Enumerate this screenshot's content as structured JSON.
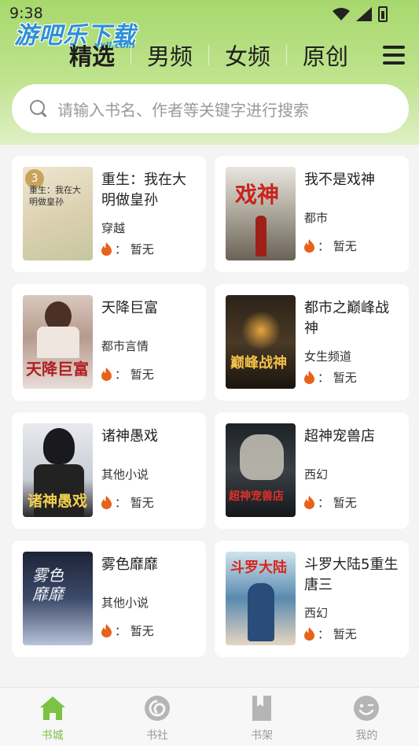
{
  "status_bar": {
    "time": "9:38"
  },
  "watermark": {
    "text": "游吧乐下载",
    "sub": "yxll.com"
  },
  "nav": {
    "tabs": [
      {
        "label": "精选",
        "active": true
      },
      {
        "label": "男频",
        "active": false
      },
      {
        "label": "女频",
        "active": false
      },
      {
        "label": "原创",
        "active": false
      }
    ],
    "menu_icon": "menu-icon"
  },
  "search": {
    "placeholder": "请输入书名、作者等关键字进行搜索",
    "icon": "search-icon"
  },
  "books": [
    {
      "title": "重生：我在大明做皇孙",
      "category": "穿越",
      "heat_label": "：  暂无",
      "cover_badge": "3",
      "cover_text": "重生：我在大明做皇孙"
    },
    {
      "title": "我不是戏神",
      "category": "都市",
      "heat_label": "：  暂无",
      "cover_text": "戏神"
    },
    {
      "title": "天降巨富",
      "category": "都市言情",
      "heat_label": "：  暂无",
      "cover_text": "天降巨富"
    },
    {
      "title": "都市之巅峰战神",
      "category": "女生频道",
      "heat_label": "：  暂无",
      "cover_text": "巅峰战神"
    },
    {
      "title": "诸神愚戏",
      "category": "其他小说",
      "heat_label": "：  暂无",
      "cover_text": "诸神愚戏"
    },
    {
      "title": "超神宠兽店",
      "category": "西幻",
      "heat_label": "：  暂无",
      "cover_text": "超神宠兽店"
    },
    {
      "title": "雾色靡靡",
      "category": "其他小说",
      "heat_label": "：  暂无",
      "cover_text": "雾色靡靡"
    },
    {
      "title": "斗罗大陆5重生唐三",
      "category": "西幻",
      "heat_label": "：  暂无",
      "cover_text": "斗罗大陆"
    }
  ],
  "tabbar": {
    "items": [
      {
        "label": "书城",
        "icon": "home-icon",
        "active": true
      },
      {
        "label": "书社",
        "icon": "community-icon",
        "active": false
      },
      {
        "label": "书架",
        "icon": "bookshelf-icon",
        "active": false
      },
      {
        "label": "我的",
        "icon": "profile-icon",
        "active": false
      }
    ]
  },
  "colors": {
    "accent": "#7cc244",
    "header_green": "#a7d86c",
    "fire": "#e8621a"
  }
}
